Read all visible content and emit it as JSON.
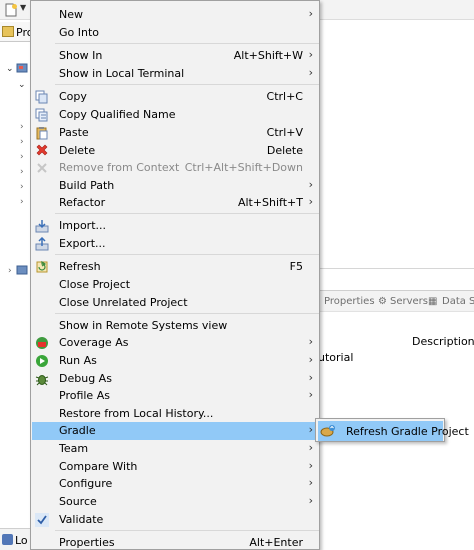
{
  "background": {
    "project_tab_label": "Pro",
    "views_bar": {
      "properties": "Properties",
      "servers": "Servers",
      "data_source": "Data Sc"
    },
    "description_header": "Description",
    "row_text": "utorial",
    "bottom_tab_label": "Lo"
  },
  "menu": {
    "items": [
      {
        "label": "New",
        "accel": "",
        "submenu": true
      },
      {
        "label": "Go Into",
        "accel": "",
        "submenu": false
      },
      {
        "label": "Show In",
        "accel": "Alt+Shift+W",
        "submenu": true
      },
      {
        "label": "Show in Local Terminal",
        "accel": "",
        "submenu": true
      },
      {
        "label": "Copy",
        "accel": "Ctrl+C",
        "submenu": false
      },
      {
        "label": "Copy Qualified Name",
        "accel": "",
        "submenu": false
      },
      {
        "label": "Paste",
        "accel": "Ctrl+V",
        "submenu": false
      },
      {
        "label": "Delete",
        "accel": "Delete",
        "submenu": false
      },
      {
        "label": "Remove from Context",
        "accel": "Ctrl+Alt+Shift+Down",
        "submenu": false,
        "disabled": true
      },
      {
        "label": "Build Path",
        "accel": "",
        "submenu": true
      },
      {
        "label": "Refactor",
        "accel": "Alt+Shift+T",
        "submenu": true
      },
      {
        "label": "Import...",
        "accel": "",
        "submenu": false
      },
      {
        "label": "Export...",
        "accel": "",
        "submenu": false
      },
      {
        "label": "Refresh",
        "accel": "F5",
        "submenu": false
      },
      {
        "label": "Close Project",
        "accel": "",
        "submenu": false
      },
      {
        "label": "Close Unrelated Project",
        "accel": "",
        "submenu": false
      },
      {
        "label": "Show in Remote Systems view",
        "accel": "",
        "submenu": false
      },
      {
        "label": "Coverage As",
        "accel": "",
        "submenu": true
      },
      {
        "label": "Run As",
        "accel": "",
        "submenu": true
      },
      {
        "label": "Debug As",
        "accel": "",
        "submenu": true
      },
      {
        "label": "Profile As",
        "accel": "",
        "submenu": true
      },
      {
        "label": "Restore from Local History...",
        "accel": "",
        "submenu": false
      },
      {
        "label": "Gradle",
        "accel": "",
        "submenu": true,
        "highlighted": true
      },
      {
        "label": "Team",
        "accel": "",
        "submenu": true
      },
      {
        "label": "Compare With",
        "accel": "",
        "submenu": true
      },
      {
        "label": "Configure",
        "accel": "",
        "submenu": true
      },
      {
        "label": "Source",
        "accel": "",
        "submenu": true
      },
      {
        "label": "Validate",
        "accel": "",
        "submenu": false,
        "checked": true
      },
      {
        "label": "Properties",
        "accel": "Alt+Enter",
        "submenu": false
      }
    ]
  },
  "submenu": {
    "refresh_gradle_label": "Refresh Gradle Project"
  },
  "icons": {
    "submenu_arrow": "›",
    "tree_collapsed": "›",
    "tree_expanded": "⌄"
  },
  "colors": {
    "highlight": "#91c9f7",
    "menu_bg": "#f2f2f2",
    "disabled_text": "#8a8a8a"
  }
}
